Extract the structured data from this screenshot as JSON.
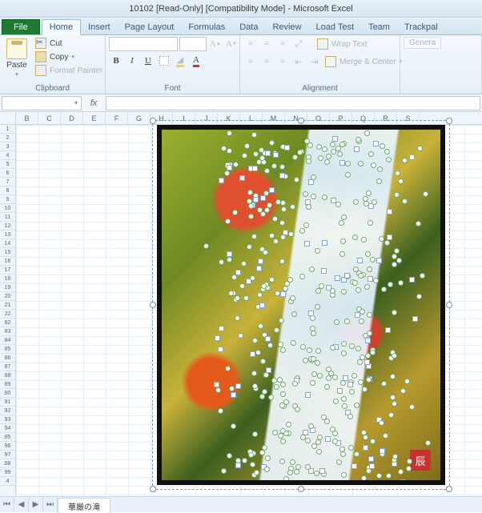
{
  "title": "10102  [Read-Only]  [Compatibility Mode] - Microsoft Excel",
  "tabs": {
    "file": "File",
    "home": "Home",
    "insert": "Insert",
    "page_layout": "Page Layout",
    "formulas": "Formulas",
    "data": "Data",
    "review": "Review",
    "load_test": "Load Test",
    "team": "Team",
    "trackpal": "Trackpal"
  },
  "ribbon": {
    "clipboard": {
      "paste": "Paste",
      "cut": "Cut",
      "copy": "Copy",
      "format_painter": "Format Painter",
      "label": "Clipboard"
    },
    "font": {
      "grow": "A",
      "shrink": "A",
      "bold": "B",
      "italic": "I",
      "underline": "U",
      "label": "Font"
    },
    "alignment": {
      "wrap": "Wrap Text",
      "merge": "Merge & Center",
      "label": "Alignment"
    },
    "number": {
      "general": "Genera"
    }
  },
  "formula_bar": {
    "namebox": "",
    "fx": "fx"
  },
  "columns": [
    "B",
    "C",
    "D",
    "E",
    "F",
    "G",
    "H",
    "I",
    "J",
    "K",
    "L",
    "M",
    "N",
    "O",
    "P",
    "Q",
    "R",
    "S"
  ],
  "rows_top": [
    "1",
    "2",
    "3",
    "4",
    "5",
    "6",
    "7",
    "8",
    "9",
    "10",
    "11",
    "12",
    "13",
    "14",
    "15",
    "16",
    "17",
    "18",
    "19",
    "20",
    "21",
    "22"
  ],
  "rows_bottom": [
    "82",
    "83",
    "84",
    "85",
    "86",
    "87",
    "88",
    "89",
    "90",
    "91",
    "92",
    "93",
    "94",
    "95",
    "96",
    "97",
    "98",
    "99",
    "4"
  ],
  "seal": "辰",
  "sheet": {
    "name": "華厳の滝"
  },
  "nav": {
    "first": "⏮",
    "prev": "◀",
    "next": "▶",
    "last": "⏭"
  }
}
